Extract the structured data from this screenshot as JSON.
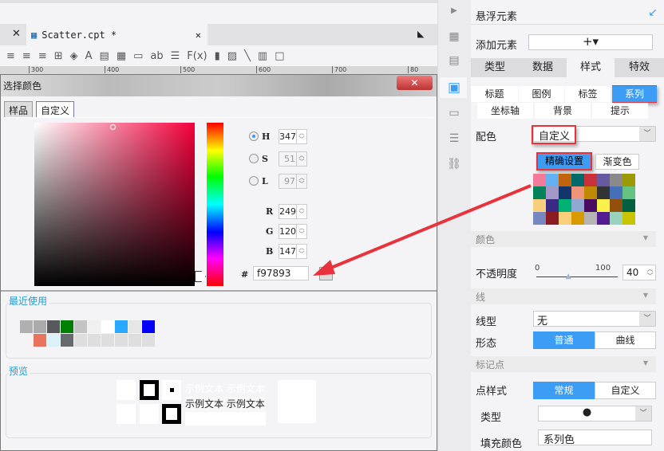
{
  "editor": {
    "tab_title": "Scatter.cpt *",
    "ruler_ticks": [
      "300",
      "400",
      "500",
      "600",
      "700",
      "80"
    ],
    "toolbar_icons": [
      "align-left-icon",
      "align-center-icon",
      "align-right-icon",
      "border-icon",
      "fill-color-icon",
      "font-color-icon",
      "merge-cells-icon",
      "grid-icon",
      "text-field-icon",
      "ab-icon",
      "paragraph-icon",
      "formula-icon",
      "chart-icon",
      "image-icon",
      "slash-icon",
      "document-icon",
      "frame-icon"
    ],
    "toolbar_glyphs": [
      "≡",
      "≡",
      "≡",
      "⊞",
      "◈",
      "A",
      "▤",
      "▦",
      "▭",
      "ab",
      "☰",
      "F(x)",
      "▮",
      "▨",
      "╲",
      "▥",
      "□"
    ]
  },
  "dialog": {
    "title": "选择颜色",
    "close": "✕",
    "tabs": [
      "样品",
      "自定义"
    ],
    "hsl": [
      {
        "label": "H",
        "value": "347",
        "selected": true
      },
      {
        "label": "S",
        "value": "51",
        "selected": false
      },
      {
        "label": "L",
        "value": "97",
        "selected": false
      }
    ],
    "rgb": [
      {
        "label": "R",
        "value": "249"
      },
      {
        "label": "G",
        "value": "120"
      },
      {
        "label": "B",
        "value": "147"
      }
    ],
    "hex_label": "#",
    "hex": "f97893",
    "recent_label": "最近使用",
    "recent_colors": [
      [
        "#b0b0b0",
        "#aaaaaa",
        "#58595c",
        "#008000",
        "#c4c4c4",
        "#f0f0f0",
        "#ffffff",
        "#29a8ff",
        "#e6e6e6",
        "#0000ff"
      ],
      [
        "#f4f4f5",
        "#e8735f",
        "#dbf1f8",
        "#676a6c",
        "#dedede",
        "#dedede",
        "#dedede",
        "#dedede",
        "#dedede",
        "#dedede"
      ]
    ],
    "preview_label": "预览",
    "sample_text": "示例文本"
  },
  "panel": {
    "title": "悬浮元素",
    "add_label": "添加元素",
    "add_button": "+▾",
    "tabs": [
      "类型",
      "数据",
      "样式",
      "特效"
    ],
    "active_tab": "样式",
    "subtabs_row1": [
      "标题",
      "图例",
      "标签",
      "系列"
    ],
    "subtabs_row2": [
      "坐标轴",
      "背景",
      "提示"
    ],
    "active_subtab": "系列",
    "scheme_label": "配色",
    "scheme_value": "自定义",
    "precise_button": "精确设置",
    "gradient_button": "渐变色",
    "palette": [
      "#f47a9a",
      "#63b1f0",
      "#c0650c",
      "#006a6b",
      "#c9303a",
      "#6a58a0",
      "#8a8a8a",
      "#9c9a00",
      "#018157",
      "#a298c8",
      "#12356b",
      "#f0947a",
      "#c08a00",
      "#333333",
      "#4670b6",
      "#66c280",
      "#f8cf7c",
      "#3b2a85",
      "#00b176",
      "#92a8d4",
      "#4a0a60",
      "#fbf04c",
      "#92500c",
      "#006040",
      "#7588c0",
      "#8c1c22",
      "#f8cf7c",
      "#d89a00",
      "#b4b4b4",
      "#541c90",
      "#9ad3bb",
      "#c8c400"
    ],
    "color_section": "颜色",
    "opacity_label": "不透明度",
    "opacity_min": "0",
    "opacity_max": "100",
    "opacity_value": "40",
    "line_section": "线",
    "line_type_label": "线型",
    "line_type_value": "无",
    "shape_label": "形态",
    "shape_options": [
      "普通",
      "曲线"
    ],
    "marker_section": "标记点",
    "marker_style_label": "点样式",
    "marker_style_options": [
      "常规",
      "自定义"
    ],
    "marker_type_label": "类型",
    "marker_type_value": "●",
    "fill_label": "填充颜色",
    "fill_value": "系列色"
  },
  "colors": {
    "accent": "#3d9df5",
    "annotation": "#e8323c",
    "selected": "#f97893"
  }
}
